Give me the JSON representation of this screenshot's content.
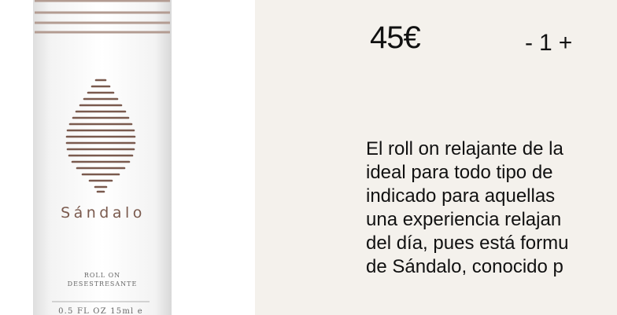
{
  "product": {
    "brand_label": "Sándalo",
    "type_label_line1": "ROLL ON",
    "type_label_line2": "DESESTRESANTE",
    "volume_label": "0.5 FL OZ   15ml e",
    "price": "45€",
    "quantity": {
      "minus": "-",
      "value": "1",
      "plus": "+"
    },
    "description_lines": [
      "El roll on relajante de la",
      "ideal para todo tipo de",
      "indicado para aquellas",
      "una experiencia relajan",
      "del día, pues está formu",
      "de Sándalo, conocido p"
    ]
  },
  "colors": {
    "accent_brown": "#7a5a4e",
    "stripe_brown": "#b39c92",
    "right_bg": "#f4f1ec"
  },
  "icons": [
    "sandalwood-leaf-icon"
  ]
}
